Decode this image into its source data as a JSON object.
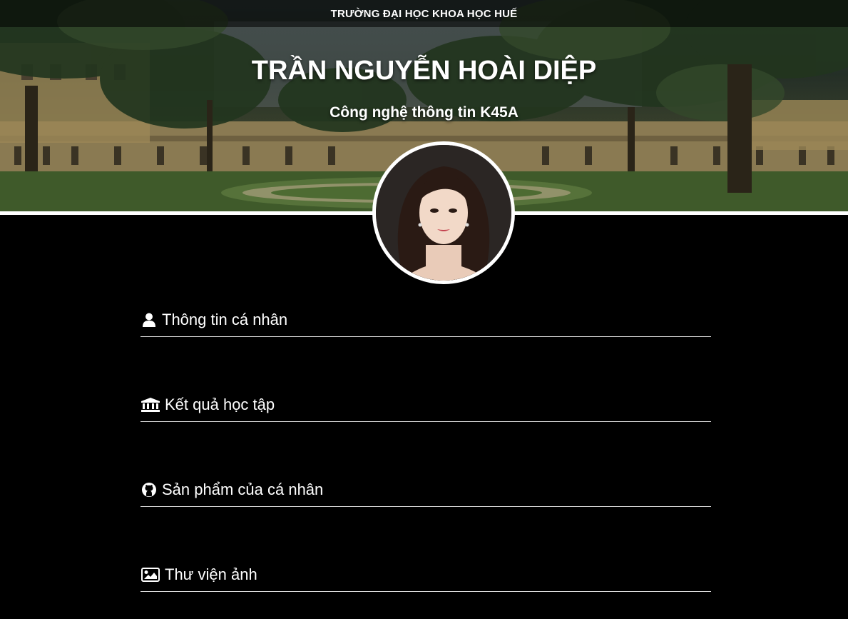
{
  "header": {
    "school": "TRƯỜNG ĐẠI HỌC KHOA HỌC HUẾ",
    "name": "TRẦN NGUYỄN HOÀI DIỆP",
    "major": "Công nghệ thông tin K45A"
  },
  "sections": [
    {
      "label": "Thông tin cá nhân",
      "icon": "user-icon"
    },
    {
      "label": "Kết quả học tập",
      "icon": "university-icon"
    },
    {
      "label": "Sản phẩm của cá nhân",
      "icon": "github-icon"
    },
    {
      "label": "Thư viện ảnh",
      "icon": "image-icon"
    }
  ],
  "colors": {
    "background": "#000000",
    "text": "#ffffff",
    "divider": "#dddddd"
  }
}
